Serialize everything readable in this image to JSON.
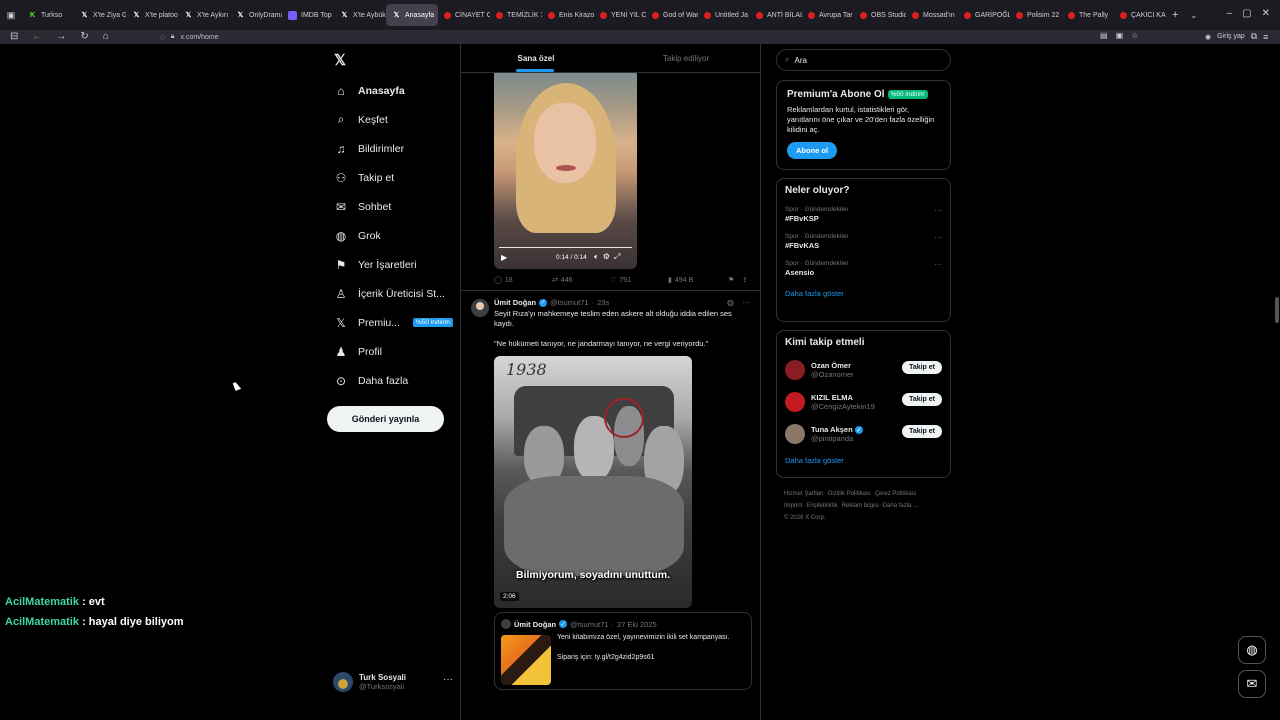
{
  "browser": {
    "tabs": [
      {
        "label": "Turkso",
        "fav": "k"
      },
      {
        "label": "X'te Ziya G",
        "fav": "x"
      },
      {
        "label": "X'te platoo",
        "fav": "x"
      },
      {
        "label": "X'te Aykırı",
        "fav": "x"
      },
      {
        "label": "OnlyDrama",
        "fav": "x"
      },
      {
        "label": "IMDB Top",
        "fav": "imdb"
      },
      {
        "label": "X'te Aybük",
        "fav": "x"
      },
      {
        "label": "Anasayfa",
        "fav": "x",
        "active": true
      },
      {
        "label": "CİNAYET O",
        "fav": "yt"
      },
      {
        "label": "TEMİZLİK 3",
        "fav": "yt"
      },
      {
        "label": "Enis Kirazo",
        "fav": "yt"
      },
      {
        "label": "YENİ YIL C",
        "fav": "yt"
      },
      {
        "label": "God of War",
        "fav": "yt"
      },
      {
        "label": "Untitled Ja",
        "fav": "yt"
      },
      {
        "label": "ANTİ BİLAL",
        "fav": "yt"
      },
      {
        "label": "Avrupa Tar",
        "fav": "yt"
      },
      {
        "label": "OBS Studio",
        "fav": "yt"
      },
      {
        "label": "Mossad'ın",
        "fav": "yt"
      },
      {
        "label": "GARİPOĞL",
        "fav": "yt"
      },
      {
        "label": "Polisim 22",
        "fav": "yt"
      },
      {
        "label": "The Pally",
        "fav": "yt"
      },
      {
        "label": "ÇAKICI KA",
        "fav": "yt"
      }
    ],
    "url": "x.com/home",
    "signin_label": "Giriş yap"
  },
  "nav": {
    "items": [
      {
        "label": "Anasayfa",
        "icon": "home-icon",
        "glyph": "⌂",
        "bold": true
      },
      {
        "label": "Keşfet",
        "icon": "search-icon",
        "glyph": "⌕"
      },
      {
        "label": "Bildirimler",
        "icon": "bell-icon",
        "glyph": "♫"
      },
      {
        "label": "Takip et",
        "icon": "follow-icon",
        "glyph": "⚇"
      },
      {
        "label": "Sohbet",
        "icon": "mail-icon",
        "glyph": "✉"
      },
      {
        "label": "Grok",
        "icon": "grok-icon",
        "glyph": "◍"
      },
      {
        "label": "Yer İşaretleri",
        "icon": "bookmark-icon",
        "glyph": "⚑"
      },
      {
        "label": "İçerik Üreticisi St...",
        "icon": "creator-studio-icon",
        "glyph": "♙"
      },
      {
        "label": "Premiu...",
        "icon": "premium-x-icon",
        "glyph": "𝕏",
        "badge": "%50 indirim"
      },
      {
        "label": "Profil",
        "icon": "profile-icon",
        "glyph": "♟"
      },
      {
        "label": "Daha fazla",
        "icon": "more-circle-icon",
        "glyph": "⊙"
      }
    ],
    "post_label": "Gönderi yayınla",
    "account": {
      "name": "Turk Sosyali",
      "handle": "@Turksosyali"
    }
  },
  "timeline": {
    "tabs": [
      "Sana özel",
      "Takip ediliyor"
    ],
    "video1": {
      "time": "0:14 / 0:14"
    },
    "actions1": {
      "replies": "18",
      "reposts": "446",
      "likes": "791",
      "views": "494 B"
    },
    "tweet2": {
      "name": "Ümit Doğan",
      "handle": "@tsumut71",
      "time": "23s",
      "text": "Seyit Rıza'yı mahkemeye teslim eden askere alt olduğu iddia edilen ses kaydı.",
      "text2": "\"Ne hükümeti tanıyor, ne jandarmayı tanıyor, ne vergi veriyordu.\"",
      "photo_year": "1938",
      "subtitle": "Bilmiyorum, soyadını unuttum.",
      "duration": "2:06",
      "quote": {
        "name": "Ümit Doğan",
        "handle": "@tsumut71",
        "date": "27 Eki 2025",
        "text": "Yeni kitabımıza özel, yayınevimizin ikili set kampanyası.",
        "text2": "Sipariş için: ty.gl/t2g4zid2p9s61"
      }
    }
  },
  "right": {
    "search_placeholder": "Ara",
    "premium": {
      "title": "Premium'a Abone Ol",
      "badge": "%50 indirim",
      "text": "Reklamlardan kurtul, istatistikleri gör, yanıtlarını öne çıkar ve 20'den fazla özelliğin kilidini aç.",
      "button": "Abone ol"
    },
    "trends": {
      "title": "Neler oluyor?",
      "items": [
        {
          "category": "Spor · Gündemdekiler",
          "name": "#FBvKSP"
        },
        {
          "category": "Spor · Gündemdekiler",
          "name": "#FBvKAS"
        },
        {
          "category": "Spor · Gündemdekiler",
          "name": "Asensio"
        }
      ],
      "more": "Daha fazla göster"
    },
    "who": {
      "title": "Kimi takip etmeli",
      "items": [
        {
          "name": "Ozan Ömer",
          "handle": "@Ozanomer",
          "color": "#8a1c24"
        },
        {
          "name": "KIZIL ELMA",
          "handle": "@CengizAytekin19",
          "color": "#c21b22"
        },
        {
          "name": "Tuna Akşen",
          "handle": "@pintipanda",
          "color": "#8a7766",
          "verified": true
        }
      ],
      "follow_label": "Takip et",
      "more": "Daha fazla göster"
    },
    "footer": [
      "Hizmet Şartları",
      "Gizlilik Politikası",
      "Çerez Politikası",
      "Imprint",
      "Erişilebilirlik",
      "Reklam bilgisi",
      "Daha fazla ...",
      "© 2026 X Corp."
    ]
  },
  "chat": [
    {
      "user": "AcilMatematik",
      "msg": " : evt"
    },
    {
      "user": "AcilMatematik",
      "msg": " : hayal diye biliyom"
    }
  ],
  "colors": {
    "accent": "#1d9bf0",
    "bg": "#000000",
    "border": "#2f3336",
    "muted": "#71767b",
    "chat_user": "#3fd8a0"
  }
}
